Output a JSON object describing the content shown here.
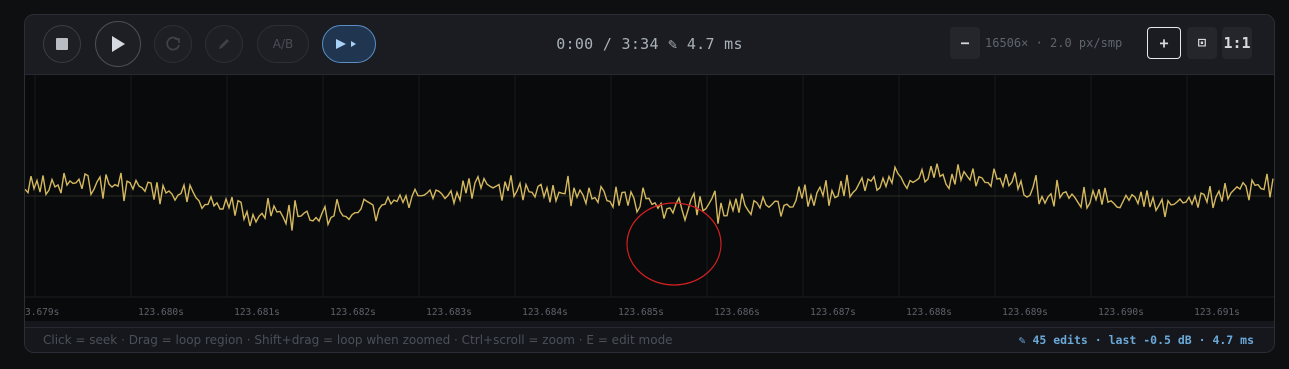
{
  "toolbar": {
    "time_display": "0:00 / 3:34 ✎ 4.7 ms",
    "ab_label": "A/B",
    "zoom_readout": "16506× · 2.0 px/smp",
    "zoom_out_label": "−",
    "zoom_in_label": "+",
    "fit_label": "⊡",
    "one_to_one_label": "1:1"
  },
  "icons": {
    "stop": "stop-icon",
    "play": "play-icon",
    "loop": "loop-icon",
    "edit": "pencil-icon",
    "play_selection": "play-selection-icon"
  },
  "timeline": {
    "ticks": [
      "3.679s",
      "123.680s",
      "123.681s",
      "123.682s",
      "123.683s",
      "123.684s",
      "123.685s",
      "123.686s",
      "123.687s",
      "123.688s",
      "123.689s",
      "123.690s",
      "123.691s"
    ]
  },
  "waveform": {
    "color": "#d4b95e",
    "annotation_color": "#d42020"
  },
  "footer": {
    "hint": "Click = seek · Drag = loop region · Shift+drag = loop when zoomed · Ctrl+scroll = zoom · E = edit mode",
    "edit_status": "✎ 45 edits · last -0.5 dB · 4.7 ms"
  },
  "colors": {
    "accent": "#6aa8d8",
    "background": "#090a0c"
  }
}
